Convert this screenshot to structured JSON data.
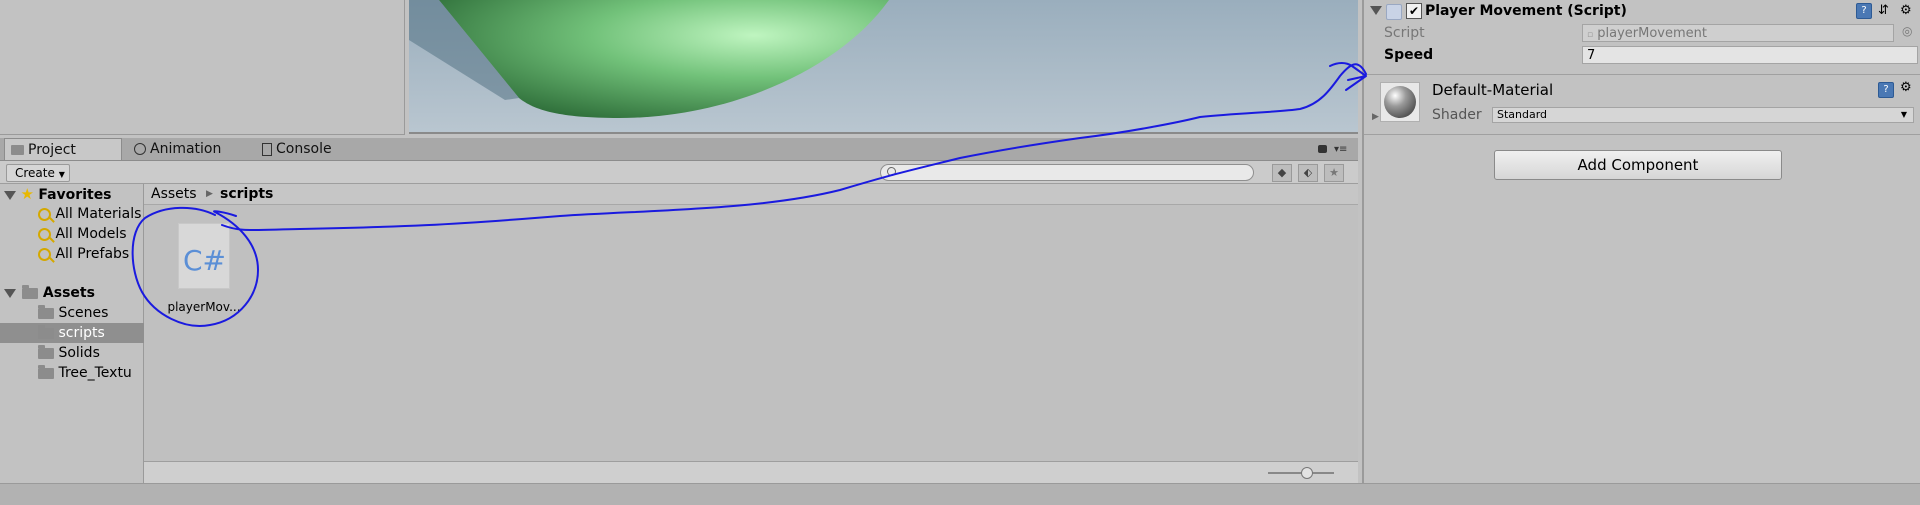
{
  "tabs": [
    {
      "label": "Project",
      "icon": "folder-icon"
    },
    {
      "label": "Animation",
      "icon": "clock-icon"
    },
    {
      "label": "Console",
      "icon": "console-icon"
    }
  ],
  "toolbar": {
    "create_label": "Create"
  },
  "favorites": {
    "label": "Favorites",
    "items": [
      "All Materials",
      "All Models",
      "All Prefabs"
    ]
  },
  "assets_tree": {
    "label": "Assets",
    "items": [
      "Scenes",
      "scripts",
      "Solids",
      "Tree_Textu"
    ],
    "selected": "scripts"
  },
  "breadcrumb": [
    "Assets",
    "scripts"
  ],
  "files": [
    {
      "name": "playerMov...",
      "icon_text": "C#"
    }
  ],
  "inspector": {
    "component_title": "Player Movement (Script)",
    "enabled": true,
    "script_label": "Script",
    "script_value": "playerMovement",
    "speed_label": "Speed",
    "speed_value": "7",
    "material_name": "Default-Material",
    "shader_label": "Shader",
    "shader_value": "Standard",
    "add_component_label": "Add Component"
  },
  "colors": {
    "annotation": "#1a1adf",
    "cs_icon_text": "#5b8fd6"
  }
}
